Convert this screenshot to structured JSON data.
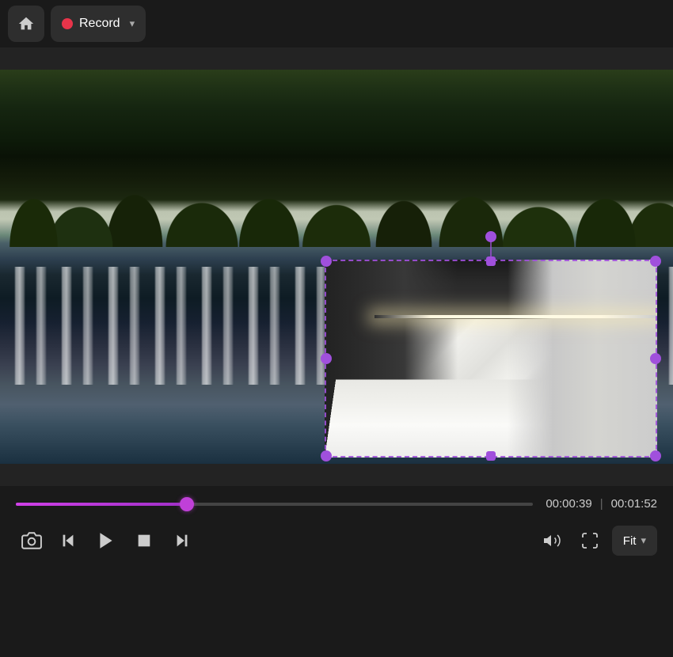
{
  "topBar": {
    "homeLabel": "Home",
    "recordLabel": "Record",
    "recordChevron": "▾"
  },
  "video": {
    "currentTime": "00:00:39",
    "totalTime": "00:01:52",
    "timeDivider": "|",
    "progressPercent": 33
  },
  "controls": {
    "snapshotIcon": "📷",
    "stepBackLabel": "◀|",
    "playLabel": "▶",
    "stopLabel": "■",
    "stepForwardLabel": "|▶",
    "volumeLabel": "🔊",
    "fitLabel": "Fit",
    "fitChevron": "▾"
  },
  "pip": {
    "visible": true
  }
}
